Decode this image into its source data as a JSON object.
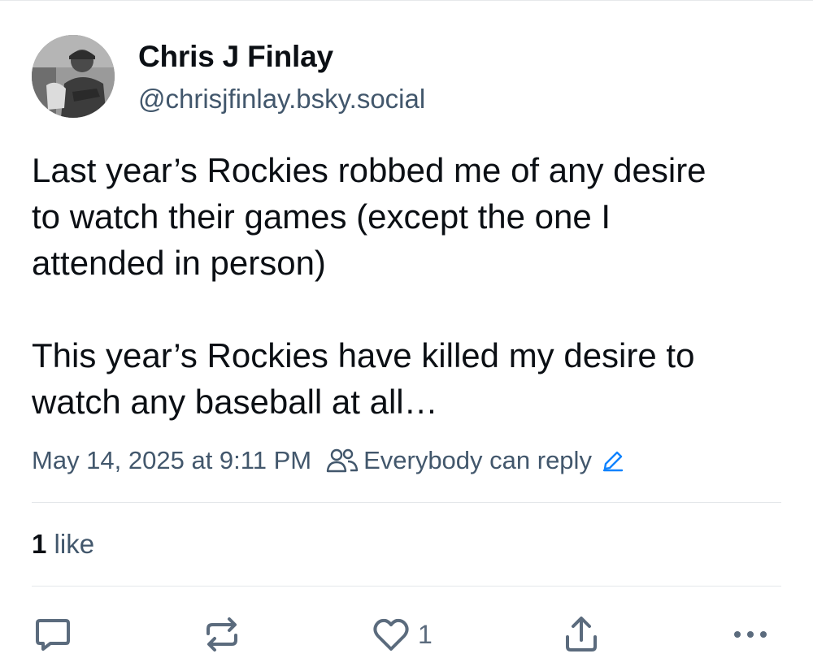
{
  "author": {
    "display_name": "Chris J Finlay",
    "handle": "@chrisjfinlay.bsky.social"
  },
  "post": {
    "lines_p1": [
      "Last year’s Rockies robbed me of any desire",
      "to watch their games (except the one I",
      "attended in person)"
    ],
    "lines_p2": [
      "This year’s Rockies have killed my desire to",
      "watch any baseball at all…"
    ],
    "timestamp": "May 14, 2025 at 9:11 PM",
    "reply_setting": "Everybody can reply"
  },
  "engagement": {
    "likes_count": "1",
    "likes_label": " like"
  },
  "actions": {
    "like_count": "1"
  },
  "icons": {
    "reply": "reply-icon",
    "repost": "repost-icon",
    "like": "heart-icon",
    "share": "share-icon",
    "more": "more-icon",
    "people": "people-icon",
    "edit": "pencil-icon"
  },
  "colors": {
    "text_primary": "#0b0f14",
    "text_secondary": "#42576c",
    "accent": "#1083fe",
    "icon": "#5b6b7d",
    "divider": "#e4e7ea"
  }
}
